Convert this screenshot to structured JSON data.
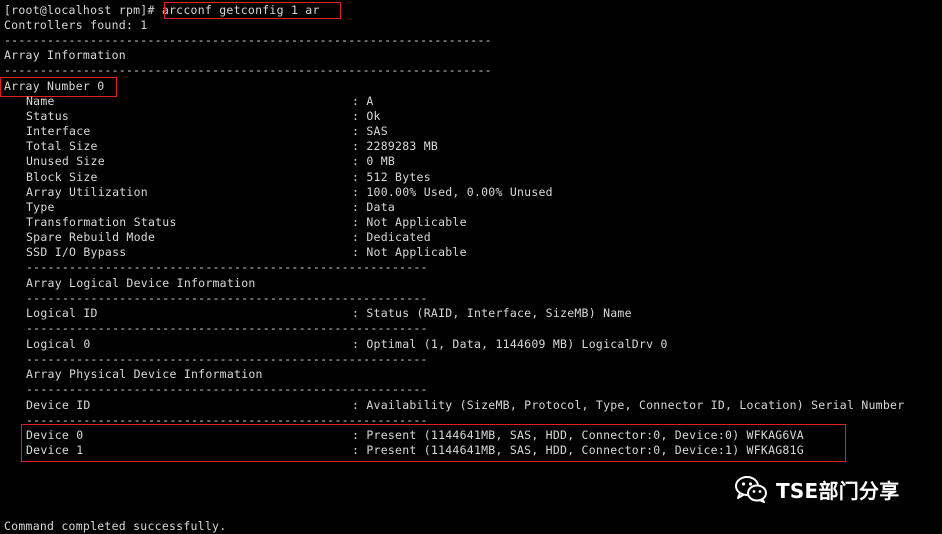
{
  "terminal": {
    "prompt": "[root@localhost rpm]# ",
    "command": "arcconf getconfig 1 ar",
    "controllers_found": "Controllers found: 1",
    "dash_long": "--------------------------------------------------------------------",
    "dash_short": "--------------------------------------------------------",
    "array_info_header": "Array Information",
    "array_number": "Array Number 0",
    "props": [
      {
        "label": "Name",
        "value": ": A"
      },
      {
        "label": "Status",
        "value": ": Ok"
      },
      {
        "label": "Interface",
        "value": ": SAS"
      },
      {
        "label": "Total Size",
        "value": ": 2289283 MB"
      },
      {
        "label": "Unused Size",
        "value": ": 0 MB"
      },
      {
        "label": "Block Size",
        "value": ": 512 Bytes"
      },
      {
        "label": "Array Utilization",
        "value": ": 100.00% Used, 0.00% Unused"
      },
      {
        "label": "Type",
        "value": ": Data"
      },
      {
        "label": "Transformation Status",
        "value": ": Not Applicable"
      },
      {
        "label": "Spare Rebuild Mode",
        "value": ": Dedicated"
      },
      {
        "label": "SSD I/O Bypass",
        "value": ": Not Applicable"
      }
    ],
    "logical_header": "Array Logical Device Information",
    "logical_cols": {
      "label": "Logical ID",
      "value": ": Status (RAID, Interface, SizeMB) Name"
    },
    "logical_row": {
      "label": "Logical 0",
      "value": ": Optimal (1, Data, 1144609 MB) LogicalDrv 0"
    },
    "physical_header": "Array Physical Device Information",
    "physical_cols": {
      "label": "Device ID",
      "value": ": Availability (SizeMB, Protocol, Type, Connector ID, Location) Serial Number"
    },
    "devices": [
      {
        "label": "Device 0",
        "value": ": Present (1144641MB, SAS, HDD, Connector:0, Device:0) WFKAG6VA"
      },
      {
        "label": "Device 1",
        "value": ": Present (1144641MB, SAS, HDD, Connector:0, Device:1) WFKAG81G"
      }
    ],
    "completion": "Command completed successfully."
  },
  "watermark": {
    "text": "TSE部门分享",
    "icon": "wechat-icon"
  },
  "colors": {
    "background": "#000000",
    "text": "#d8d8d8",
    "highlight": "#e02020"
  }
}
